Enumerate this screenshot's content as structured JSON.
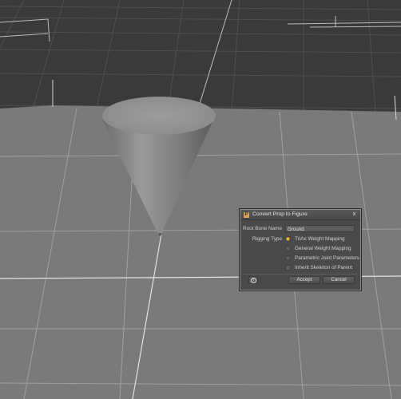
{
  "dialog": {
    "title": "Convert Prop to Figure",
    "close_glyph": "x",
    "app_icon_glyph": "P",
    "root_bone_label": "Root Bone Name",
    "root_bone_value": "Ground",
    "rigging_type_label": "Rigging Type",
    "rigging_options": [
      {
        "label": "TriAx Weight Mapping",
        "selected": true
      },
      {
        "label": "General Weight Mapping",
        "selected": false
      },
      {
        "label": "Parametric Joint Parameters",
        "selected": false
      }
    ],
    "inherit_skeleton_label": "Inherit Skeleton of Parent",
    "inherit_skeleton_checked": false,
    "help_glyph": "?",
    "accept_label": "Accept",
    "cancel_label": "Cancel"
  },
  "viewport": {
    "background_color": "#3a3a3a",
    "ground_color": "#7a7a7a",
    "grid_color": "#d0d0d0",
    "object": "cone"
  }
}
